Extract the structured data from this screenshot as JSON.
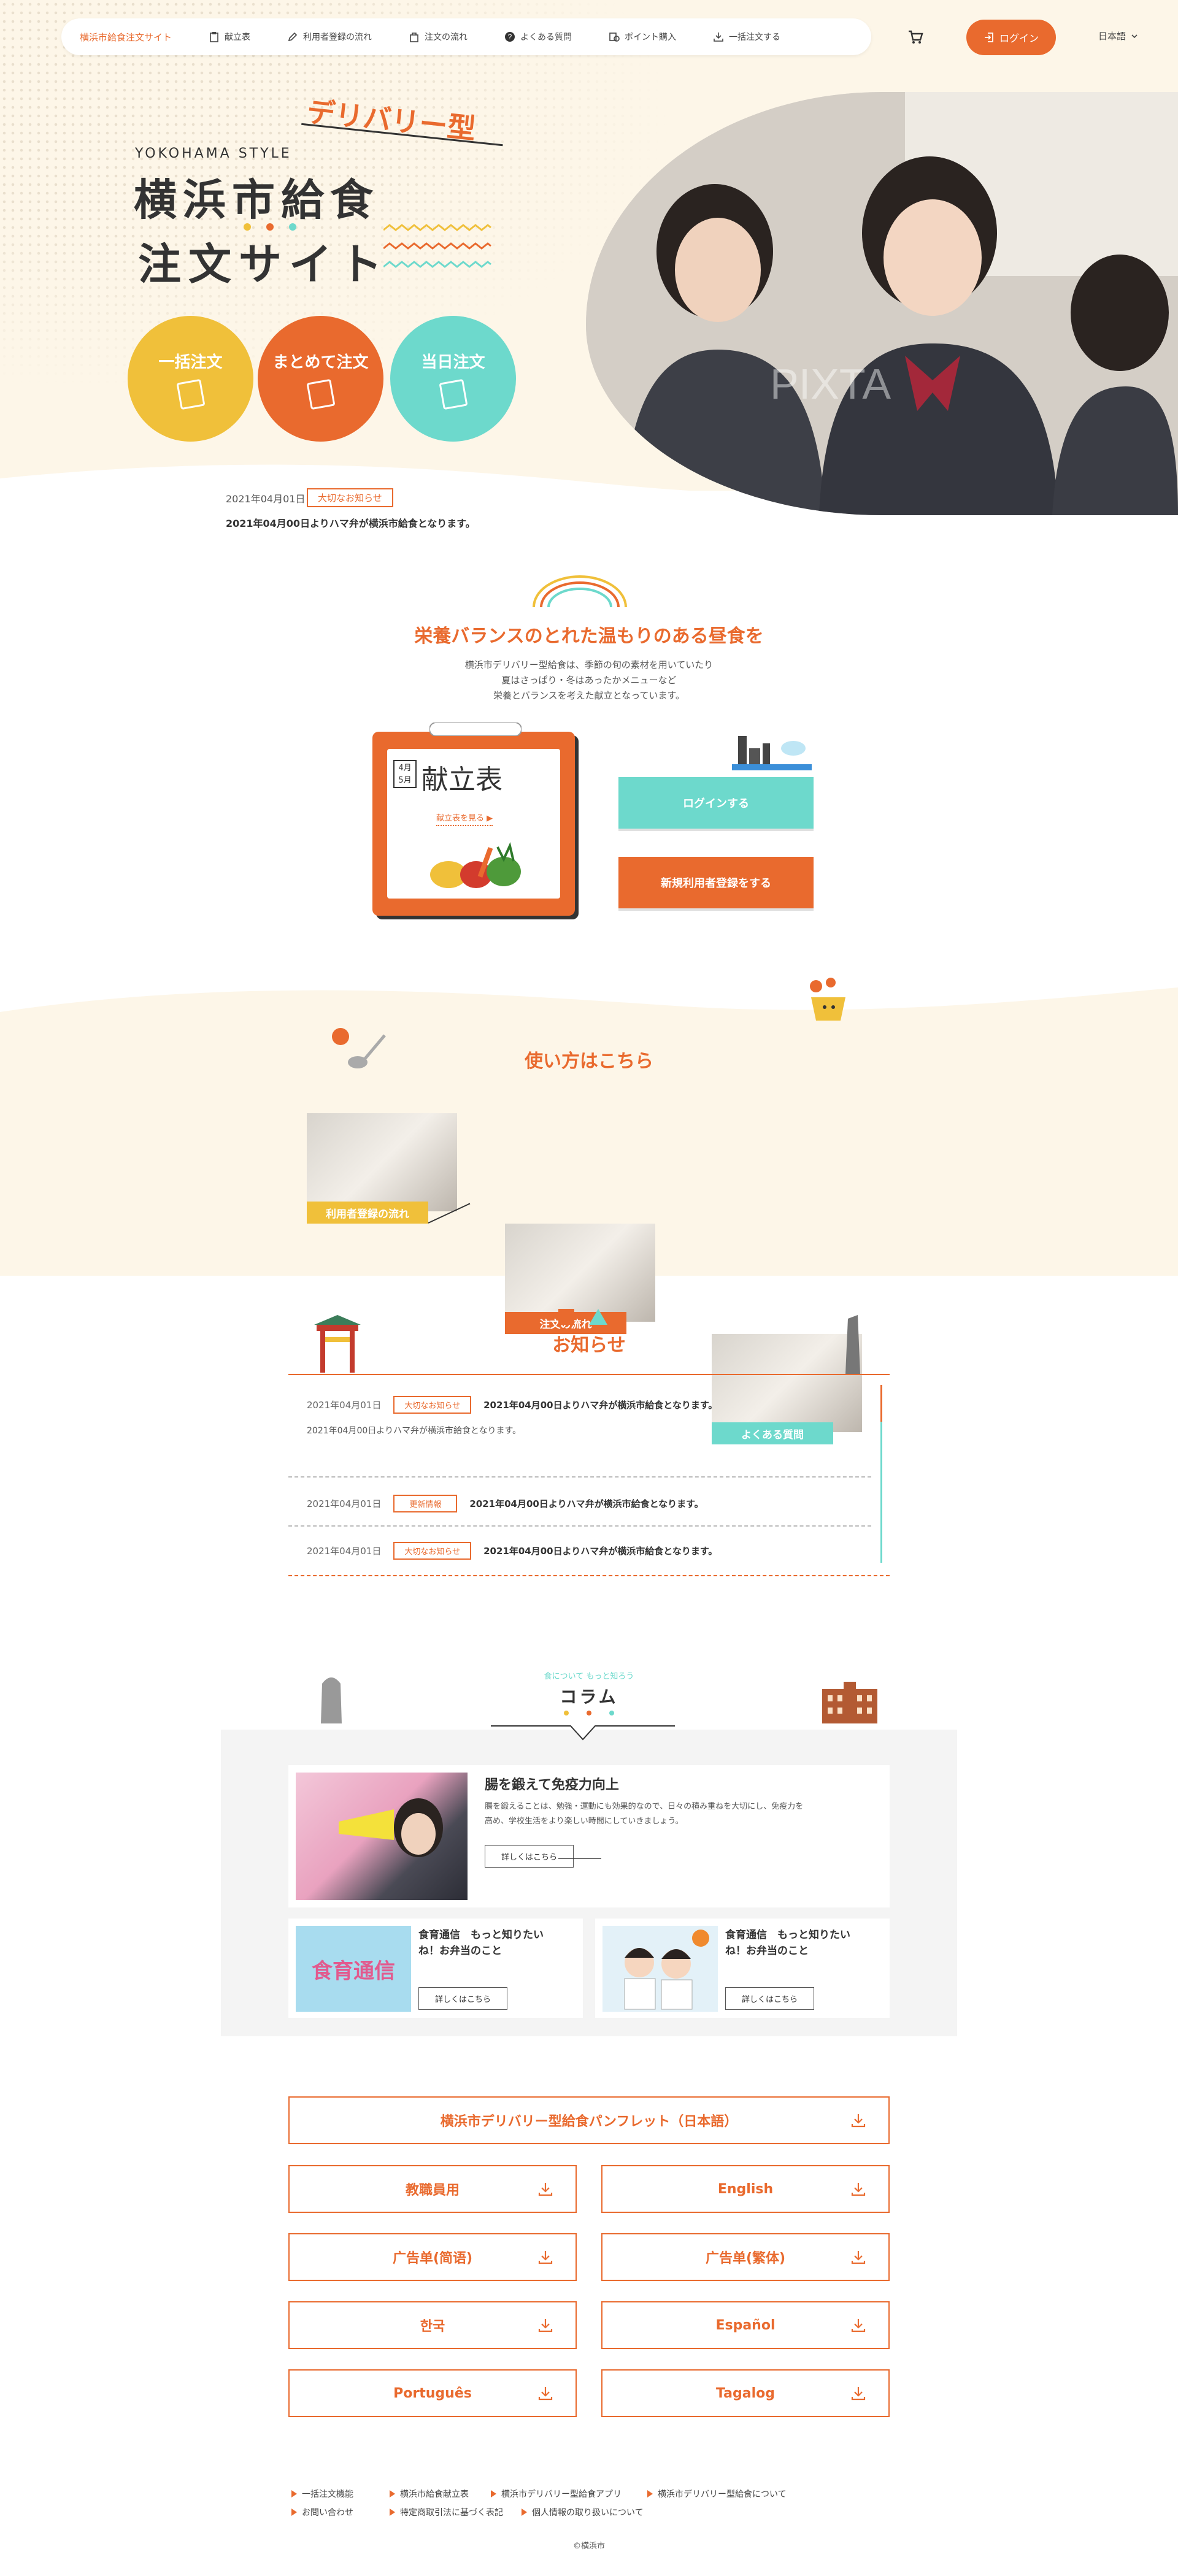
{
  "header": {
    "site_name": "横浜市給食注文サイト",
    "nav": [
      {
        "label": "献立表",
        "icon": "clipboard-icon"
      },
      {
        "label": "利用者登録の流れ",
        "icon": "pencil-icon"
      },
      {
        "label": "注文の流れ",
        "icon": "bag-icon"
      },
      {
        "label": "よくある質問",
        "icon": "question-icon"
      },
      {
        "label": "ポイント購入",
        "icon": "coins-icon"
      },
      {
        "label": "一括注文する",
        "icon": "download-icon"
      }
    ],
    "login_label": "ログイン",
    "language": "日本語"
  },
  "hero": {
    "tag": "デリバリー型",
    "eyebrow": "YOKOHAMA STYLE",
    "title_line1": "横浜市給食",
    "title_line2": "注文サイト",
    "circles": [
      {
        "label": "一括注文",
        "color": "#f0c03a"
      },
      {
        "label": "まとめて注文",
        "color": "#e96a2e"
      },
      {
        "label": "当日注文",
        "color": "#6dd9cc"
      }
    ],
    "watermark": "PIXTA"
  },
  "top_news": {
    "date": "2021年04月01日",
    "badge": "大切なお知らせ",
    "title": "2021年04月00日よりハマ弁が横浜市給食となります。"
  },
  "nutrition": {
    "title": "栄養バランスのとれた温もりのある昼食を",
    "lines": [
      "横浜市デリバリー型給食は、季節の旬の素材を用いていたり",
      "夏はさっぱり・冬はあったかメニューなど",
      "栄養とバランスを考えた献立となっています。"
    ],
    "menu_month": "4月\n5月",
    "menu_month_a": "4月",
    "menu_month_b": "5月",
    "menu_title": "献立表",
    "menu_link": "献立表を見る",
    "login_button": "ログインする",
    "register_button": "新規利用者登録をする"
  },
  "howto": {
    "title": "使い方はこちら",
    "cards": [
      {
        "label": "利用者登録の流れ",
        "color": "#f0c03a"
      },
      {
        "label": "注文の流れ",
        "color": "#e96a2e"
      },
      {
        "label": "よくある質問",
        "color": "#6dd9cc"
      }
    ]
  },
  "news": {
    "title": "お知らせ",
    "items": [
      {
        "date": "2021年04月01日",
        "badge": "大切なお知らせ",
        "title": "2021年04月00日よりハマ弁が横浜市給食となります。",
        "body": "2021年04月00日よりハマ弁が横浜市給食となります。"
      },
      {
        "date": "2021年04月01日",
        "badge": "更新情報",
        "title": "2021年04月00日よりハマ弁が横浜市給食となります。"
      },
      {
        "date": "2021年04月01日",
        "badge": "大切なお知らせ",
        "title": "2021年04月00日よりハマ弁が横浜市給食となります。"
      }
    ]
  },
  "column": {
    "kicker": "食について もっと知ろう",
    "title": "コラム",
    "feature": {
      "title": "腸を鍛えて免疫力向上",
      "body_1": "腸を鍛えることは、勉強・運動にも効果的なので、日々の積み重ねを大切にし、免疫力を",
      "body_2": "高め、学校生活をより楽しい時間にしていきましょう。",
      "more": "詳しくはこちら"
    },
    "cards": [
      {
        "title_1": "食育通信　もっと知りたい",
        "title_2": "ね！お弁当のこと",
        "image_text": "食育通信",
        "more": "詳しくはこちら"
      },
      {
        "title_1": "食育通信　もっと知りたい",
        "title_2": "ね！お弁当のこと",
        "more": "詳しくはこちら"
      }
    ]
  },
  "downloads": {
    "full": "横浜市デリバリー型給食パンフレット（日本語）",
    "items": [
      "教職員用",
      "English",
      "广告单(简语)",
      "广告单(繁体)",
      "한국",
      "Español",
      "Português",
      "Tagalog"
    ]
  },
  "footer": {
    "links": [
      "一括注文機能",
      "横浜市給食献立表",
      "横浜市デリバリー型給食アプリ",
      "横浜市デリバリー型給食について",
      "お問い合わせ",
      "特定商取引法に基づく表記",
      "個人情報の取り扱いについて"
    ],
    "copyright": "©横浜市"
  },
  "colors": {
    "accent": "#e96a2e",
    "yellow": "#f0c03a",
    "teal": "#6dd9cc",
    "cream": "#fdf6e8"
  }
}
